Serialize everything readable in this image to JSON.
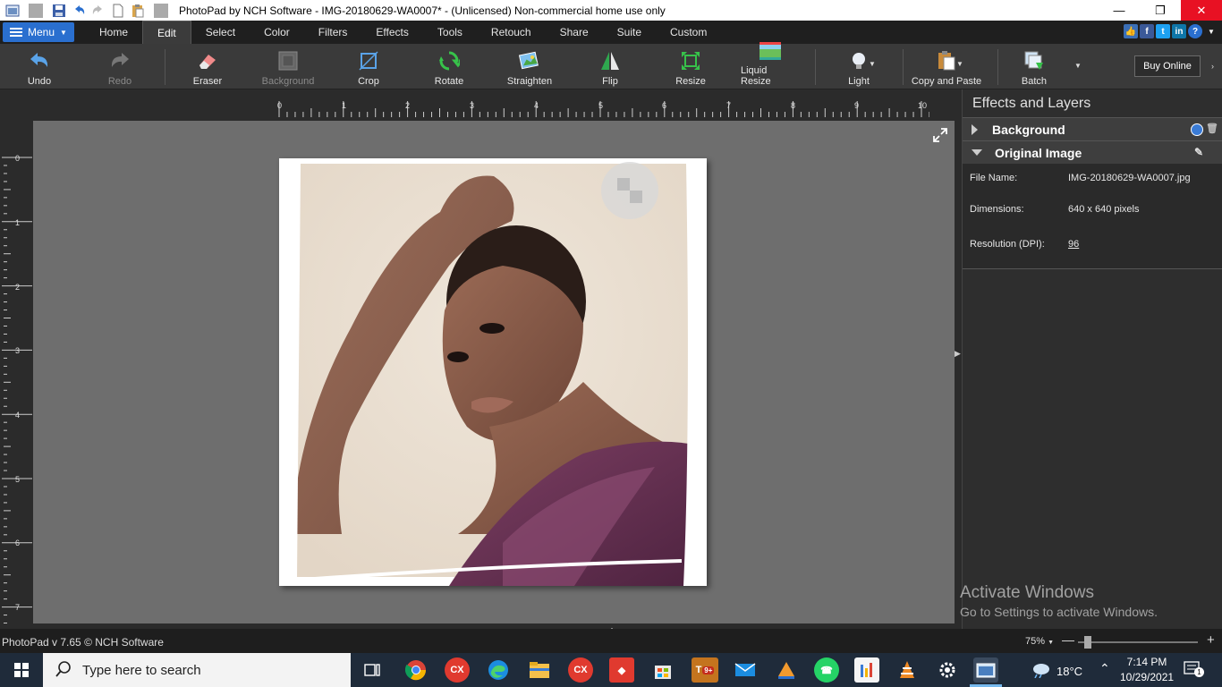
{
  "window": {
    "title": "PhotoPad by NCH Software - IMG-20180629-WA0007* - (Unlicensed) Non-commercial home use only"
  },
  "menu": {
    "menu_label": "Menu",
    "tabs": [
      "Home",
      "Edit",
      "Select",
      "Color",
      "Filters",
      "Effects",
      "Tools",
      "Retouch",
      "Share",
      "Suite",
      "Custom"
    ],
    "active_tab": "Edit"
  },
  "toolbar": {
    "undo": "Undo",
    "redo": "Redo",
    "eraser": "Eraser",
    "background": "Background",
    "crop": "Crop",
    "rotate": "Rotate",
    "straighten": "Straighten",
    "flip": "Flip",
    "resize": "Resize",
    "liquid_resize": "Liquid Resize",
    "light": "Light",
    "copy_paste": "Copy and Paste",
    "batch": "Batch",
    "buy_online": "Buy Online"
  },
  "ruler": {
    "h_ticks": [
      "0",
      "1",
      "2",
      "3",
      "4",
      "5",
      "6",
      "7",
      "8",
      "9",
      "10"
    ],
    "v_ticks": [
      "0",
      "1",
      "2",
      "3",
      "4",
      "5",
      "6",
      "7"
    ]
  },
  "panel": {
    "title": "Effects and Layers",
    "layers": [
      "Background",
      "Original Image"
    ],
    "file_name_label": "File Name:",
    "file_name": "IMG-20180629-WA0007.jpg",
    "dimensions_label": "Dimensions:",
    "dimensions": "640 x 640 pixels",
    "resolution_label": "Resolution (DPI):",
    "resolution": "96"
  },
  "activate": {
    "line1": "Activate Windows",
    "line2": "Go to Settings to activate Windows."
  },
  "status": {
    "text": "PhotoPad v 7.65 © NCH Software",
    "zoom": "75%"
  },
  "taskbar": {
    "search_placeholder": "Type here to search",
    "weather": "18°C",
    "time": "7:14 PM",
    "date": "10/29/2021",
    "teams_badge": "9+",
    "notification_count": "1"
  }
}
